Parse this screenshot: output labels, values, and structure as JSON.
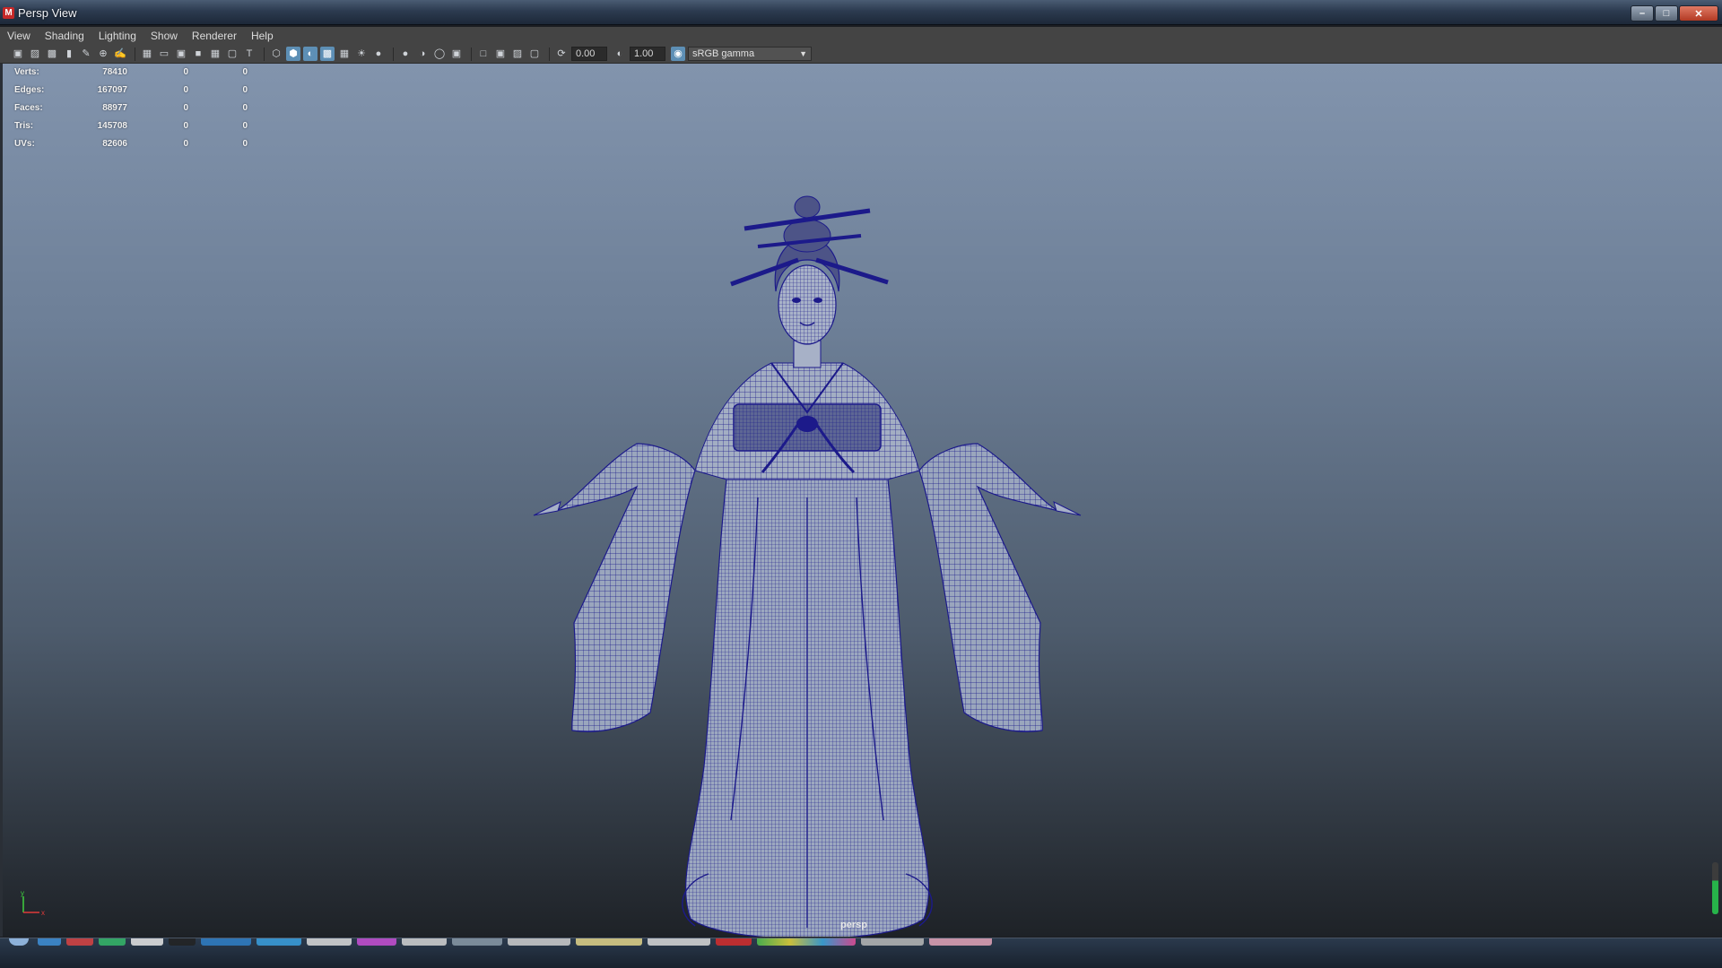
{
  "window": {
    "title": "Persp View",
    "app_icon": "maya-icon",
    "controls": [
      "minimize-icon",
      "maximize-icon",
      "close-icon"
    ]
  },
  "menubar": {
    "items": [
      "View",
      "Shading",
      "Lighting",
      "Show",
      "Renderer",
      "Help"
    ]
  },
  "toolbar": {
    "exposure_value": "0.00",
    "gamma_value": "1.00",
    "color_space": "sRGB gamma"
  },
  "hud": {
    "rows": [
      {
        "label": "Verts:",
        "v1": "78410",
        "v2": "0",
        "v3": "0"
      },
      {
        "label": "Edges:",
        "v1": "167097",
        "v2": "0",
        "v3": "0"
      },
      {
        "label": "Faces:",
        "v1": "88977",
        "v2": "0",
        "v3": "0"
      },
      {
        "label": "Tris:",
        "v1": "145708",
        "v2": "0",
        "v3": "0"
      },
      {
        "label": "UVs:",
        "v1": "82606",
        "v2": "0",
        "v3": "0"
      }
    ]
  },
  "viewport": {
    "camera_label": "persp",
    "axis_labels": {
      "x": "x",
      "y": "y"
    },
    "wireframe_color": "#1c1a8a",
    "model_fill_color": "#9aa6bd"
  },
  "colors": {
    "background_top": "#8294ad",
    "background_bottom": "#1e2227",
    "ui_panel": "#444444",
    "accent": "#5d8fb5"
  }
}
